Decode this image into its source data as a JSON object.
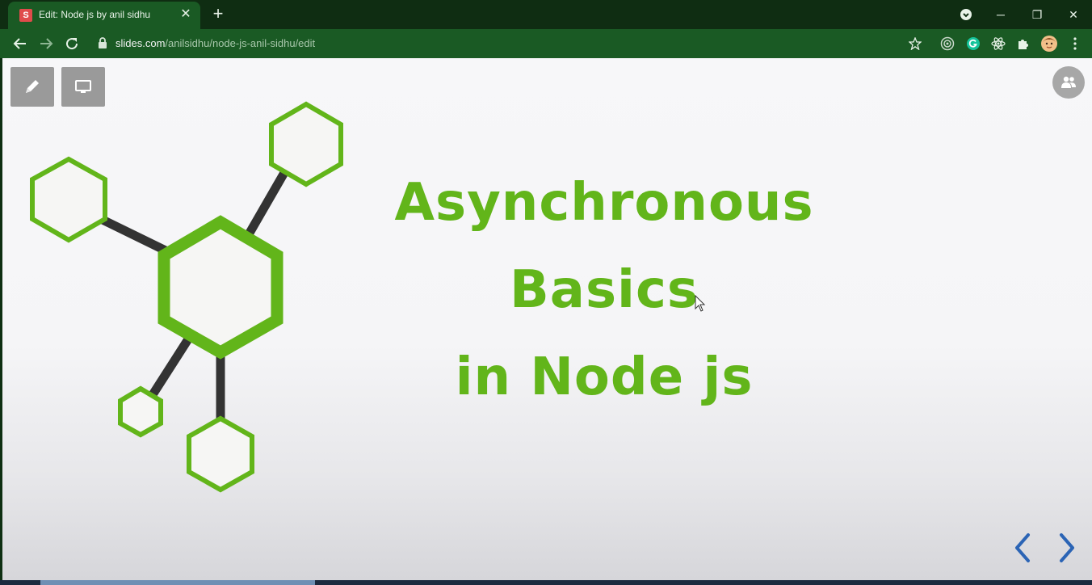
{
  "browser": {
    "tab": {
      "favicon_letter": "S",
      "title": "Edit: Node js by anil sidhu",
      "close_glyph": "✕"
    },
    "new_tab_glyph": "+",
    "window_controls": {
      "minimize": "─",
      "restore": "❐",
      "close": "✕"
    },
    "address": {
      "host": "slides.com",
      "path": "/anilsidhu/node-js-anil-sidhu/edit"
    }
  },
  "slide": {
    "title_lines": [
      "Asynchronous",
      "Basics",
      "in Node js"
    ],
    "accent_color": "#62b51a",
    "nav_arrow_color": "#2b64b5"
  },
  "icons": {
    "edit_tool": "pencil-icon",
    "present_tool": "monitor-icon",
    "collaborators": "people-icon",
    "previous": "chevron-left-icon",
    "next": "chevron-right-icon"
  }
}
